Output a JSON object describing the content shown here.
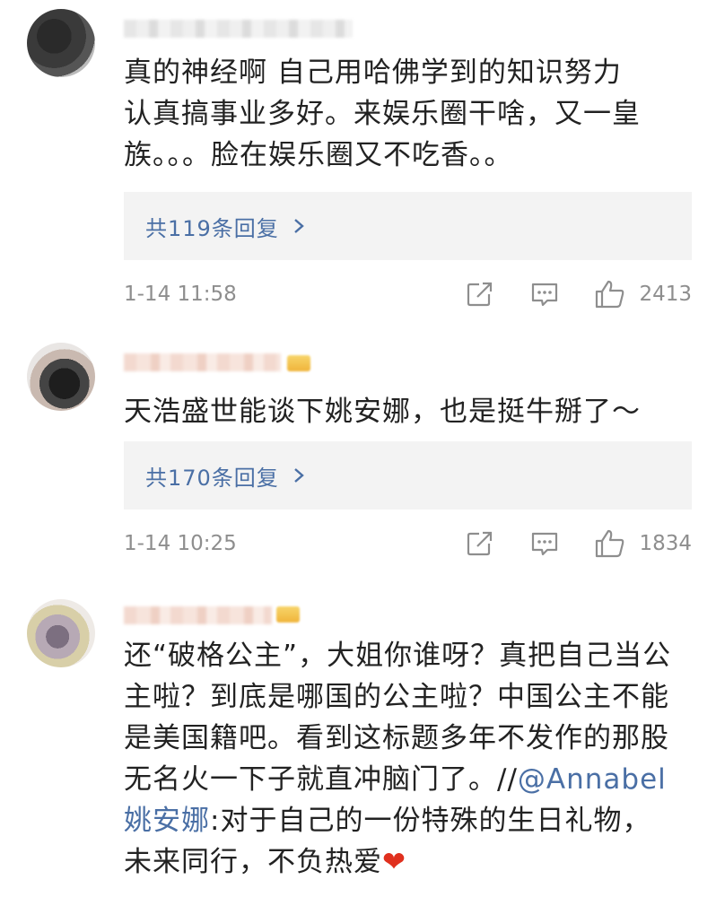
{
  "comments": [
    {
      "text": "真的神经啊 自己用哈佛学到的知识努力认真搞事业多好。来娱乐圈干啥，又一皇族。。。脸在娱乐圈又不吃香。。",
      "lines": [
        "真的神经啊 自己用哈佛学到的知识努力",
        "认真搞事业多好。来娱乐圈干啥，又一皇",
        "族。。。脸在娱乐圈又不吃香。。"
      ],
      "replies_label": "共119条回复",
      "time": "1-14 11:58",
      "likes": "2413"
    },
    {
      "text": "天浩盛世能谈下姚安娜，也是挺牛掰了～",
      "lines": [
        "天浩盛世能谈下姚安娜，也是挺牛掰了～"
      ],
      "replies_label": "共170条回复",
      "time": "1-14 10:25",
      "likes": "1834"
    },
    {
      "lines": [
        "还“破格公主”，大姐你谁呀？真把自己当公",
        "主啦？到底是哪国的公主啦？中国公主不能",
        "是美国籍吧。看到这标题多年不发作的那股",
        "无名火一下子就直冲脑门了。//"
      ],
      "mention": "@Annabel姚安娜",
      "mention_line1": "@Annabel",
      "mention_line2": "姚安娜",
      "after_mention": ":对于自己的一份特殊的生日礼物，",
      "last_line": "未来同行，不负热爱",
      "emoji": "❤"
    }
  ],
  "icons": [
    "share-icon",
    "comment-icon",
    "like-icon",
    "chevron-right-icon"
  ],
  "colors": {
    "link": "#4a6fa5",
    "meta": "#8e8e8e",
    "reply_bg": "#f3f3f3",
    "heart": "#e0301e"
  }
}
